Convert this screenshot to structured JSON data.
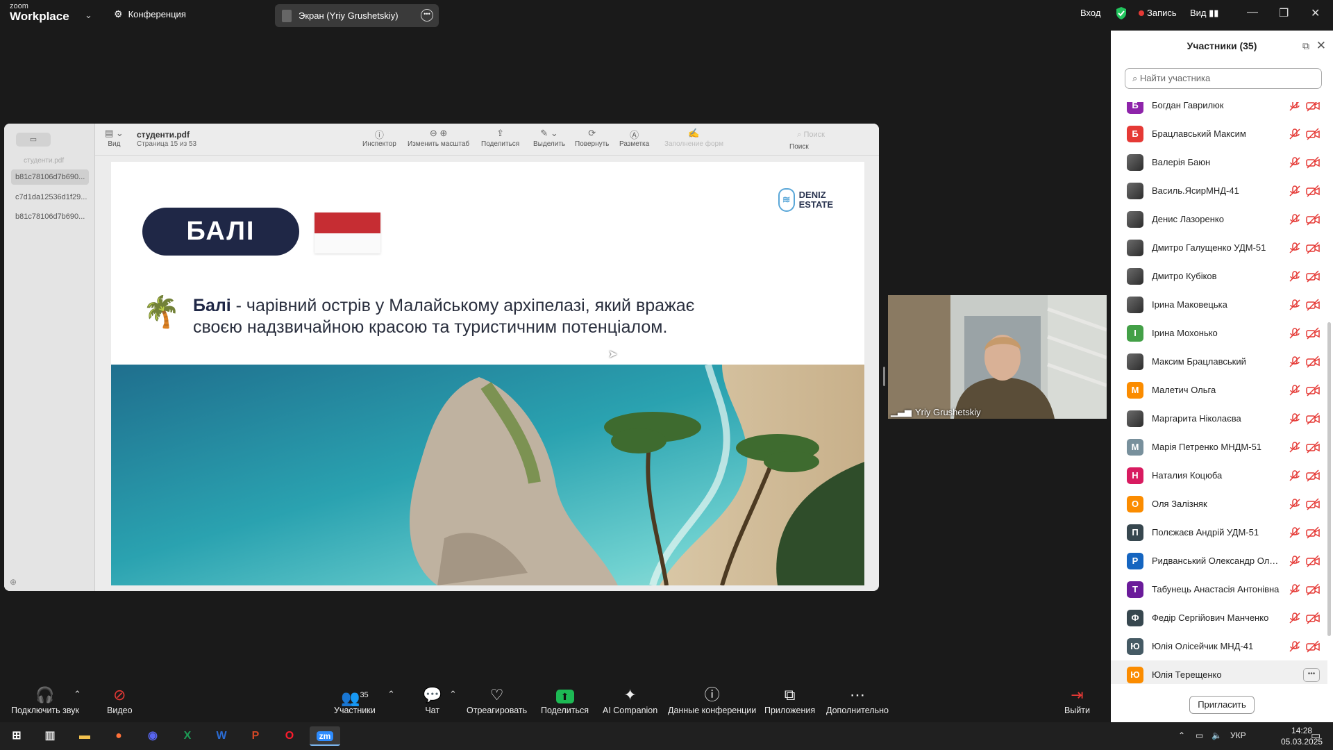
{
  "app": {
    "logo_top": "zoom",
    "logo_bottom": "Workplace",
    "meeting_label": "Конференция",
    "share_title": "Экран (Yriy Grushetskiy)",
    "signin": "Вход",
    "recording": "Запись",
    "view": "Вид"
  },
  "pdf": {
    "file": "студенти.pdf",
    "page_info": "Страница 15 из 53",
    "sidebar_file": "студенти.pdf",
    "thumbs": [
      "b81c78106d7b690...",
      "c7d1da12536d1f29...",
      "b81c78106d7b690..."
    ],
    "toolbar": {
      "view": "Вид",
      "inspector": "Инспектор",
      "zoom": "Изменить масштаб",
      "share": "Поделиться",
      "highlight": "Выделить",
      "rotate": "Повернуть",
      "markup": "Разметка",
      "form": "Заполнение форм",
      "search_placeholder": "Поиск",
      "search": "Поиск"
    }
  },
  "slide": {
    "badge": "БАЛІ",
    "logo_line1": "DENIZ",
    "logo_line2": "ESTATE",
    "bold": "Балі",
    "text1": " - чарівний острів у Малайському архіпелазі, який вражає",
    "text2": "своєю надзвичайною красою та туристичним потенціалом."
  },
  "video": {
    "name": "Yriy Grushetskiy"
  },
  "participants": {
    "title": "Участники (35)",
    "search_placeholder": "Найти участника",
    "invite": "Пригласить",
    "list": [
      {
        "initial": "Б",
        "name": "Богдан Гаврилюк",
        "color": "#8e24aa"
      },
      {
        "initial": "Б",
        "name": "Брацлавський Максим",
        "color": "#e53935"
      },
      {
        "initial": "",
        "name": "Валерія Баюн",
        "color": ""
      },
      {
        "initial": "",
        "name": "Василь.ЯсирМНД-41",
        "color": ""
      },
      {
        "initial": "",
        "name": "Денис Лазоренко",
        "color": ""
      },
      {
        "initial": "",
        "name": "Дмитро Галущенко УДМ-51",
        "color": ""
      },
      {
        "initial": "",
        "name": "Дмитро Кубіков",
        "color": ""
      },
      {
        "initial": "",
        "name": "Ірина Маковецька",
        "color": ""
      },
      {
        "initial": "І",
        "name": "Ірина Мохонько",
        "color": "#43a047"
      },
      {
        "initial": "",
        "name": "Максим Брацлавський",
        "color": ""
      },
      {
        "initial": "М",
        "name": "Малетич Ольга",
        "color": "#fb8c00"
      },
      {
        "initial": "",
        "name": "Маргарита Ніколаєва",
        "color": ""
      },
      {
        "initial": "М",
        "name": "Марія Петренко МНДМ-51",
        "color": "#78909c"
      },
      {
        "initial": "Н",
        "name": "Наталия Коцюба",
        "color": "#d81b60"
      },
      {
        "initial": "О",
        "name": "Оля Залізняк",
        "color": "#fb8c00"
      },
      {
        "initial": "П",
        "name": "Полєжаєв Андрій УДМ-51",
        "color": "#37474f"
      },
      {
        "initial": "Р",
        "name": "Ридванський Олександр Олександрович",
        "color": "#1565c0"
      },
      {
        "initial": "Т",
        "name": "Табунець Анастасія Антонівна",
        "color": "#6a1b9a"
      },
      {
        "initial": "Ф",
        "name": "Федір Сергійович Манченко",
        "color": "#37474f"
      },
      {
        "initial": "Ю",
        "name": "Юлія Олісейчик МНД-41",
        "color": "#455a64"
      },
      {
        "initial": "Ю",
        "name": "Юлія Терещенко",
        "color": "#fb8c00"
      }
    ]
  },
  "toolbar": {
    "audio": "Подключить звук",
    "video": "Видео",
    "participants": "Участники",
    "participants_count": "35",
    "chat": "Чат",
    "react": "Отреагировать",
    "share": "Поделиться",
    "ai": "AI Companion",
    "info": "Данные конференции",
    "apps": "Приложения",
    "more": "Дополнительно",
    "leave": "Выйти"
  },
  "taskbar": {
    "lang": "УКР",
    "time": "14:28",
    "date": "05.03.2025"
  }
}
